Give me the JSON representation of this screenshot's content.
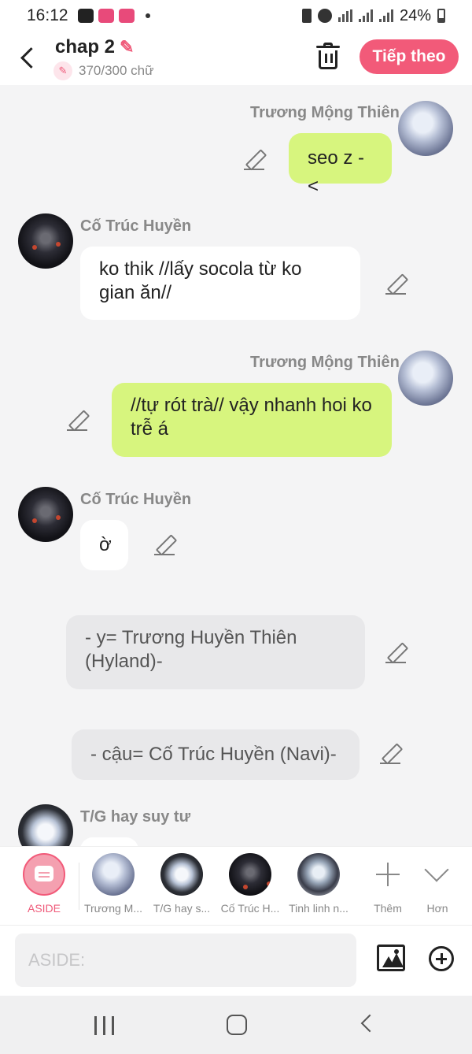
{
  "status_bar": {
    "time": "16:12",
    "battery": "24%"
  },
  "header": {
    "title": "chap 2",
    "counter": "370/300 chữ",
    "next_label": "Tiếp theo"
  },
  "messages": [
    {
      "sender": "Trương Mộng Thiên",
      "text": "seo z -<"
    },
    {
      "sender": "Cố Trúc Huyền",
      "text": "ko thik //lấy socola từ ko gian ăn//"
    },
    {
      "sender": "Trương Mộng Thiên",
      "text": "//tự rót trà// vậy nhanh hoi ko trễ á"
    },
    {
      "sender": "Cố Trúc Huyền",
      "text": "ờ"
    },
    {
      "sender": "",
      "text": "- y= Trương Huyền Thiên (Hyland)-"
    },
    {
      "sender": "",
      "text": "- cậu= Cố Trúc Huyền (Navi)-"
    },
    {
      "sender": "T/G hay suy tư",
      "text": ""
    }
  ],
  "tabs": [
    {
      "label": "ASIDE"
    },
    {
      "label": "Trương M..."
    },
    {
      "label": "T/G hay s..."
    },
    {
      "label": "Cố Trúc H..."
    },
    {
      "label": "Tinh linh n..."
    },
    {
      "label": "Thêm"
    },
    {
      "label": "Hơn"
    }
  ],
  "input": {
    "placeholder": "ASIDE:"
  },
  "colors": {
    "accent": "#f25a79",
    "bubble_self": "#d7f57e",
    "bubble_other": "#ffffff",
    "bubble_aside": "#e8e8ea"
  }
}
